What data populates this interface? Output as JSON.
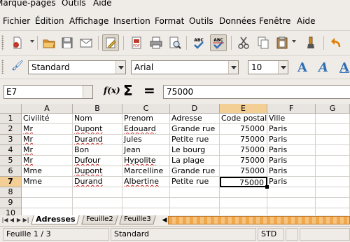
{
  "top_menu": [
    "Marque-pages",
    "Outils",
    "Aide"
  ],
  "menubar": [
    "Fichier",
    "Édition",
    "Affichage",
    "Insertion",
    "Format",
    "Outils",
    "Données",
    "Fenêtre",
    "Aide"
  ],
  "toolbar1": {
    "icons": [
      "new-document-icon",
      "open-folder-icon",
      "save-icon",
      "email-icon",
      "edit-file-icon",
      "export-pdf-icon",
      "print-icon",
      "print-preview-icon",
      "spellcheck-icon",
      "autospellcheck-icon",
      "cut-icon",
      "copy-icon",
      "paste-icon",
      "clone-format-icon",
      "undo-icon"
    ],
    "pdf_label": "PDF",
    "abc_label": "ABC"
  },
  "toolbar2": {
    "style": "Standard",
    "font": "Arial",
    "size": "10",
    "font_buttons": [
      "A",
      "A",
      "A"
    ]
  },
  "formula_bar": {
    "cell_ref": "E7",
    "fx_label": "f(x)",
    "sigma_label": "Σ",
    "equal_label": "=",
    "content": "75000"
  },
  "grid": {
    "columns": [
      "A",
      "B",
      "C",
      "D",
      "E",
      "F",
      "G"
    ],
    "selected_column": "E",
    "selected_row": "7",
    "rows": [
      {
        "num": "1",
        "cells": [
          "Civilité",
          "Nom",
          "Prenom",
          "Adresse",
          "Code postal",
          "Ville",
          ""
        ]
      },
      {
        "num": "2",
        "cells": [
          "Mr",
          "Dupont",
          "Edouard",
          "Grande rue",
          "75000",
          "Paris",
          ""
        ]
      },
      {
        "num": "3",
        "cells": [
          "Mr",
          "Durand",
          "Jules",
          "Petite rue",
          "75000",
          "Paris",
          ""
        ]
      },
      {
        "num": "4",
        "cells": [
          "Mr",
          "Bon",
          "Jean",
          "Le bourg",
          "75000",
          "Paris",
          ""
        ]
      },
      {
        "num": "5",
        "cells": [
          "Mr",
          "Dufour",
          "Hypolite",
          "La plage",
          "75000",
          "Paris",
          ""
        ]
      },
      {
        "num": "6",
        "cells": [
          "Mme",
          "Dupont",
          "Marcelline",
          "Grande rue",
          "75000",
          "Paris",
          ""
        ]
      },
      {
        "num": "7",
        "cells": [
          "Mme",
          "Durand",
          "Albertine",
          "Petite rue",
          "75000",
          "Paris",
          ""
        ]
      },
      {
        "num": "8",
        "cells": [
          "",
          "",
          "",
          "",
          "",
          "",
          ""
        ]
      },
      {
        "num": "9",
        "cells": [
          "",
          "",
          "",
          "",
          "",
          "",
          ""
        ]
      },
      {
        "num": "10",
        "cells": [
          "",
          "",
          "",
          "",
          "",
          "",
          ""
        ]
      }
    ]
  },
  "sheet_tabs": [
    "Adresses",
    "Feuille2",
    "Feuille3"
  ],
  "active_sheet": "Adresses",
  "status": {
    "sheet": "Feuille 1 / 3",
    "style": "Standard",
    "mode": "STD"
  },
  "colors": {
    "selection_header": "#f3cf96",
    "scrollbar": "#f0a84a",
    "spell_underline": "#d03030"
  }
}
